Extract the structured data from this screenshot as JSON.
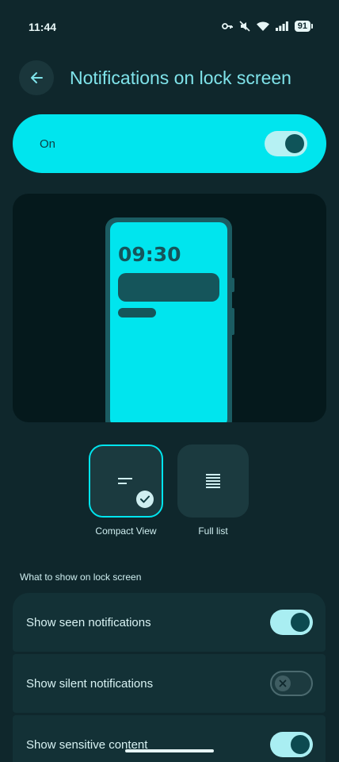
{
  "status_bar": {
    "time": "11:44",
    "battery": "91"
  },
  "header": {
    "title": "Notifications on lock screen"
  },
  "master_toggle": {
    "label": "On",
    "state": "on"
  },
  "preview": {
    "time": "09:30"
  },
  "style_options": [
    {
      "label": "Compact View",
      "selected": true
    },
    {
      "label": "Full list",
      "selected": false
    }
  ],
  "section": {
    "title": "What to show on lock screen"
  },
  "settings": [
    {
      "label": "Show seen notifications",
      "state": "on"
    },
    {
      "label": "Show silent notifications",
      "state": "off"
    },
    {
      "label": "Show sensitive content",
      "state": "on"
    }
  ],
  "colors": {
    "accent": "#00e5ee",
    "background": "#0f272c",
    "title": "#7fe3ea"
  }
}
